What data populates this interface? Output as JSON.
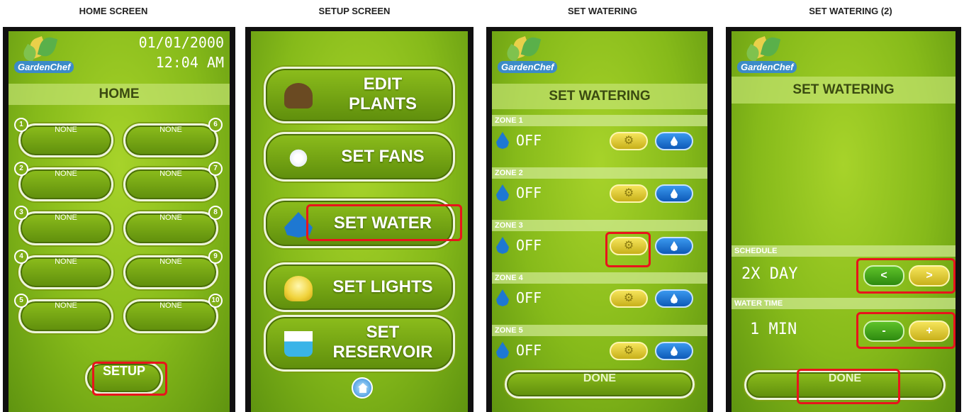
{
  "captions": {
    "home": "HOME SCREEN",
    "setup": "SETUP SCREEN",
    "set_watering": "SET WATERING",
    "set_watering_2": "SET WATERING  (2)"
  },
  "brand": {
    "logo_text": "GardenChef"
  },
  "home": {
    "date": "01/01/2000",
    "time": "12:04 AM",
    "title": "HOME",
    "slots": [
      {
        "num": "1",
        "label": "NONE"
      },
      {
        "num": "6",
        "label": "NONE"
      },
      {
        "num": "2",
        "label": "NONE"
      },
      {
        "num": "7",
        "label": "NONE"
      },
      {
        "num": "3",
        "label": "NONE"
      },
      {
        "num": "8",
        "label": "NONE"
      },
      {
        "num": "4",
        "label": "NONE"
      },
      {
        "num": "9",
        "label": "NONE"
      },
      {
        "num": "5",
        "label": "NONE"
      },
      {
        "num": "10",
        "label": "NONE"
      }
    ],
    "setup_label": "SETUP"
  },
  "setup": {
    "buttons": [
      {
        "line1": "EDIT",
        "line2": "PLANTS",
        "icon": "seedling-icon"
      },
      {
        "line1": "SET FANS",
        "line2": "",
        "icon": "fan-icon"
      },
      {
        "line1": "SET WATER",
        "line2": "",
        "icon": "water-drop-icon"
      },
      {
        "line1": "SET LIGHTS",
        "line2": "",
        "icon": "light-bulb-icon"
      },
      {
        "line1": "SET",
        "line2": "RESERVOIR",
        "icon": "reservoir-icon"
      }
    ],
    "home_icon": "home-icon"
  },
  "watering": {
    "title": "SET WATERING",
    "zones": [
      {
        "label": "ZONE 1",
        "status": "OFF"
      },
      {
        "label": "ZONE 2",
        "status": "OFF"
      },
      {
        "label": "ZONE 3",
        "status": "OFF"
      },
      {
        "label": "ZONE 4",
        "status": "OFF"
      },
      {
        "label": "ZONE 5",
        "status": "OFF"
      }
    ],
    "gear_glyph": "⚙",
    "drop_glyph": "💧",
    "done_label": "DONE"
  },
  "watering2": {
    "title": "SET WATERING",
    "schedule_label": "SCHEDULE",
    "schedule_value": "2X DAY",
    "prev_glyph": "<",
    "next_glyph": ">",
    "water_time_label": "WATER TIME",
    "water_time_value": "1 MIN",
    "minus_glyph": "-",
    "plus_glyph": "+",
    "done_label": "DONE"
  },
  "colors": {
    "screen_green": "#86ba1a",
    "highlight_red": "#e8141c",
    "water_blue": "#1e78d2",
    "gear_yellow": "#f5e45a"
  }
}
